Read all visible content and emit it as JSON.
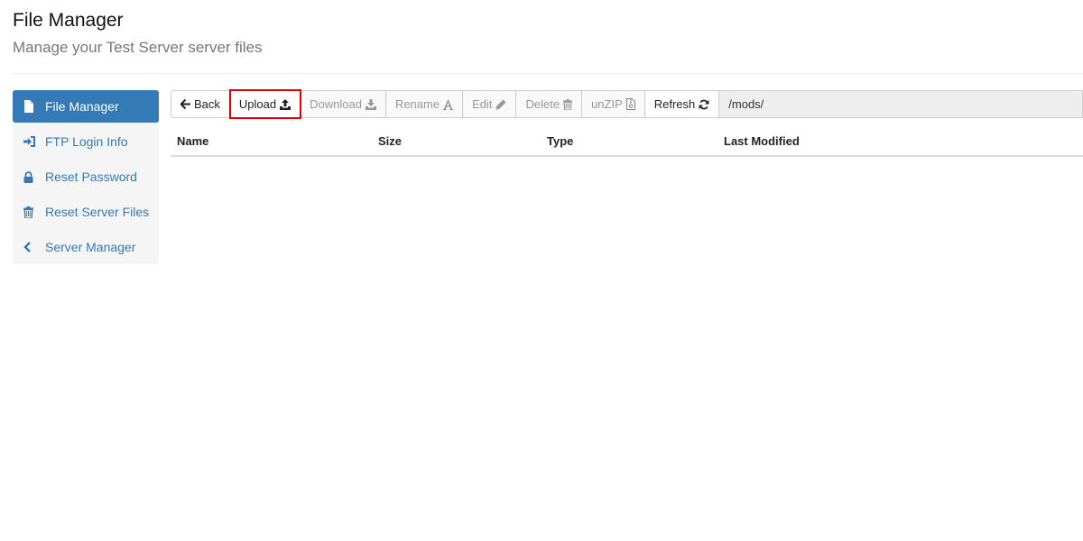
{
  "header": {
    "title": "File Manager",
    "subtitle": "Manage your Test Server server files"
  },
  "sidebar": {
    "items": [
      {
        "label": "File Manager",
        "icon": "file-icon",
        "active": true
      },
      {
        "label": "FTP Login Info",
        "icon": "sign-in-icon",
        "active": false
      },
      {
        "label": "Reset Password",
        "icon": "lock-icon",
        "active": false
      },
      {
        "label": "Reset Server Files",
        "icon": "trash-icon",
        "active": false
      },
      {
        "label": "Server Manager",
        "icon": "chevron-left-icon",
        "active": false
      }
    ]
  },
  "toolbar": {
    "back_label": "Back",
    "upload_label": "Upload",
    "download_label": "Download",
    "rename_label": "Rename",
    "edit_label": "Edit",
    "delete_label": "Delete",
    "unzip_label": "unZIP",
    "refresh_label": "Refresh",
    "current_path": "/mods/"
  },
  "table": {
    "columns": [
      "Name",
      "Size",
      "Type",
      "Last Modified"
    ],
    "rows": []
  },
  "colors": {
    "accent": "#337ab7",
    "highlight": "#e00000",
    "disabled_text": "#999999"
  }
}
